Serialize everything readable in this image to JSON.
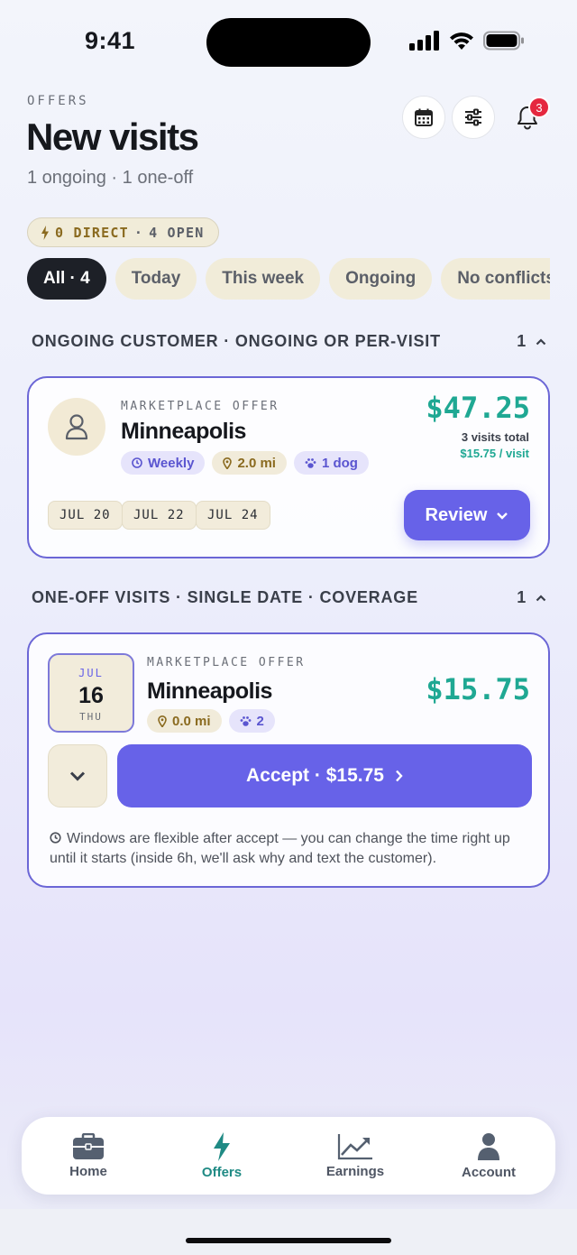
{
  "status_bar": {
    "time": "9:41"
  },
  "header": {
    "eyebrow": "OFFERS",
    "title": "New visits",
    "subtitle": "1 ongoing · 1 one-off",
    "notification_count": "3"
  },
  "summary": {
    "direct": "0 DIRECT",
    "separator": "·",
    "open": "4 OPEN"
  },
  "filters": [
    {
      "label": "All · 4",
      "active": true
    },
    {
      "label": "Today"
    },
    {
      "label": "This week"
    },
    {
      "label": "Ongoing"
    },
    {
      "label": "No conflicts"
    }
  ],
  "sections": {
    "ongoing": {
      "title": "ONGOING CUSTOMER · ONGOING OR PER-VISIT",
      "count": "1"
    },
    "oneoff": {
      "title": "ONE-OFF VISITS · SINGLE DATE · COVERAGE",
      "count": "1"
    }
  },
  "ongoing_card": {
    "eyebrow": "MARKETPLACE OFFER",
    "city": "Minneapolis",
    "tags": {
      "frequency": "Weekly",
      "distance": "2.0 mi",
      "pets": "1 dog"
    },
    "price": "$47.25",
    "visits_total": "3 visits total",
    "per_visit": "$15.75 / visit",
    "dates": [
      "JUL 20",
      "JUL 22",
      "JUL 24"
    ],
    "review_label": "Review"
  },
  "oneoff_card": {
    "date": {
      "month": "JUL",
      "day": "16",
      "weekday": "THU"
    },
    "eyebrow": "MARKETPLACE OFFER",
    "city": "Minneapolis",
    "tags": {
      "distance": "0.0 mi",
      "pets": "2"
    },
    "price": "$15.75",
    "accept_label": "Accept · $15.75",
    "note": "Windows are flexible after accept — you can change the time right up until it starts (inside 6h, we'll ask why and text the customer)."
  },
  "tabbar": {
    "home": "Home",
    "offers": "Offers",
    "earnings": "Earnings",
    "account": "Account"
  },
  "colors": {
    "accent": "#6762e8",
    "price": "#1fa893",
    "active_tab": "#1f8a84",
    "badge": "#e5283f"
  }
}
